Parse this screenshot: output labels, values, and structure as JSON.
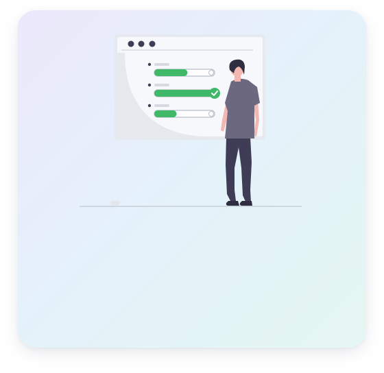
{
  "illustration": {
    "name": "progress-checklist-illustration",
    "icon": "check-icon",
    "rows": [
      {
        "progress": 0.55,
        "complete": false
      },
      {
        "progress": 1.0,
        "complete": true
      },
      {
        "progress": 0.37,
        "complete": false
      }
    ]
  },
  "colors": {
    "accent": "#3fb86a",
    "ink": "#3f3d56",
    "panel_bg": "#f5f7fa",
    "panel_shape": "#e5e8ed",
    "muted": "#d6dae0"
  }
}
